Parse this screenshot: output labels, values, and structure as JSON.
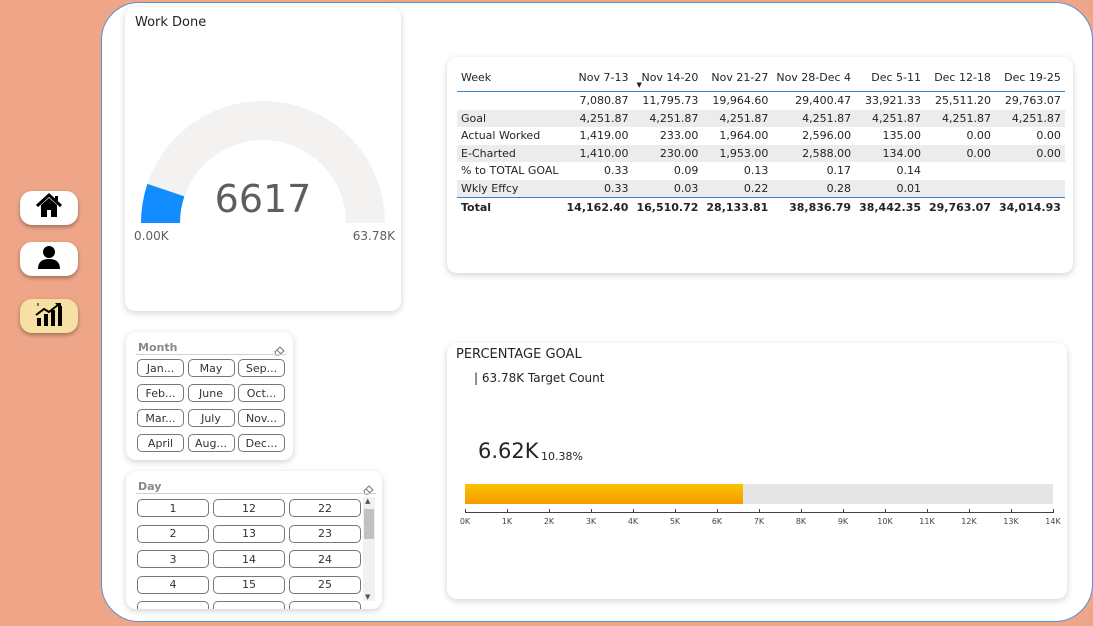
{
  "nav": {
    "items": [
      {
        "icon": "home-icon"
      },
      {
        "icon": "user-icon"
      },
      {
        "icon": "chart-growth-icon"
      }
    ]
  },
  "gauge": {
    "title": "Work Done",
    "value": "6617",
    "min_label": "0.00K",
    "max_label": "63.78K",
    "value_num": 6617,
    "max_num": 63780,
    "fill_color": "#118dff",
    "track_color": "#f3f2f1"
  },
  "matrix": {
    "headers": [
      "Week",
      "Nov 7-13",
      "Nov 14-20",
      "Nov 21-27",
      "Nov 28-Dec 4",
      "Dec 5-11",
      "Dec 12-18",
      "Dec 19-25"
    ],
    "sorted_column": "Nov 14-20",
    "rows": [
      {
        "label": "",
        "values": [
          "7,080.87",
          "11,795.73",
          "19,964.60",
          "29,400.47",
          "33,921.33",
          "25,511.20",
          "29,763.07"
        ]
      },
      {
        "label": "Goal",
        "values": [
          "4,251.87",
          "4,251.87",
          "4,251.87",
          "4,251.87",
          "4,251.87",
          "4,251.87",
          "4,251.87"
        ]
      },
      {
        "label": "Actual Worked",
        "values": [
          "1,419.00",
          "233.00",
          "1,964.00",
          "2,596.00",
          "135.00",
          "0.00",
          "0.00"
        ]
      },
      {
        "label": "E-Charted",
        "values": [
          "1,410.00",
          "230.00",
          "1,953.00",
          "2,588.00",
          "134.00",
          "0.00",
          "0.00"
        ]
      },
      {
        "label": "% to TOTAL GOAL",
        "values": [
          "0.33",
          "0.09",
          "0.13",
          "0.17",
          "0.14",
          "",
          ""
        ]
      },
      {
        "label": "Wkly Effcy",
        "values": [
          "0.33",
          "0.03",
          "0.22",
          "0.28",
          "0.01",
          "",
          ""
        ]
      }
    ],
    "total": {
      "label": "Total",
      "values": [
        "14,162.40",
        "16,510.72",
        "28,133.81",
        "38,836.79",
        "38,442.35",
        "29,763.07",
        "34,014.93"
      ]
    }
  },
  "month_slicer": {
    "title": "Month",
    "options": [
      "Jan...",
      "May",
      "Sep...",
      "Feb...",
      "June",
      "Oct...",
      "Mar...",
      "July",
      "Nov...",
      "April",
      "Aug...",
      "Dec..."
    ]
  },
  "day_slicer": {
    "title": "Day",
    "options": [
      "1",
      "12",
      "22",
      "2",
      "13",
      "23",
      "3",
      "14",
      "24",
      "4",
      "15",
      "25"
    ]
  },
  "percentage_goal": {
    "title": "PERCENTAGE GOAL",
    "target_label": "| 63.78K Target Count",
    "value_label": "6.62K",
    "percent_label": "10.38%",
    "value_num": 6620,
    "axis_max": 14000,
    "ticks": [
      "0K",
      "1K",
      "2K",
      "3K",
      "4K",
      "5K",
      "6K",
      "7K",
      "8K",
      "9K",
      "10K",
      "11K",
      "12K",
      "13K",
      "14K"
    ],
    "bar_color": "#f6a800"
  }
}
